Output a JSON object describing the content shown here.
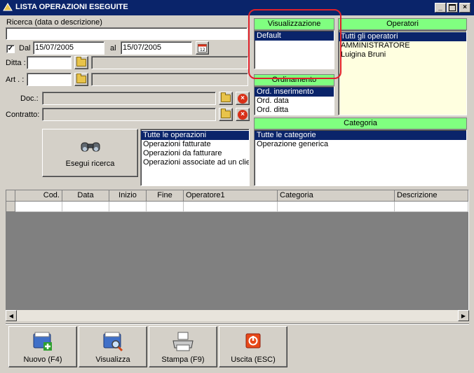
{
  "window": {
    "title": "LISTA OPERAZIONI ESEGUITE"
  },
  "search": {
    "label": "Ricerca (data o descrizione)",
    "value": "",
    "dal_label": "Dal",
    "dal_checked": true,
    "date_from": "15/07/2005",
    "al_label": "al",
    "date_to": "15/07/2005",
    "ditta_label": "Ditta :",
    "art_label": "Art . :",
    "doc_label": "Doc.:",
    "contratto_label": "Contratto:",
    "exec_button": "Esegui ricerca"
  },
  "operation_filter": {
    "items": [
      "Tutte le operazioni",
      "Operazioni fatturate",
      "Operazioni da fatturare",
      "Operazioni associate ad un clier"
    ],
    "selected_index": 0
  },
  "visualizzazione": {
    "header": "Visualizzazione",
    "items": [
      "Default"
    ],
    "selected_index": 0
  },
  "ordinamento": {
    "header": "Ordinamento",
    "items": [
      "Ord. inserimento",
      "Ord. data",
      "Ord. ditta"
    ],
    "selected_index": 0
  },
  "operatori": {
    "header": "Operatori",
    "items": [
      "Tutti gli operatori",
      "AMMINISTRATORE",
      "Luigina Bruni"
    ],
    "selected_index": 0
  },
  "categoria": {
    "header": "Categoria",
    "items": [
      "Tutte le categorie",
      "Operazione generica"
    ],
    "selected_index": 0
  },
  "grid": {
    "columns": [
      "Cod.",
      "Data",
      "Inizio",
      "Fine",
      "Operatore1",
      "Categoria",
      "Descrizione"
    ]
  },
  "footer": {
    "new_button": "Nuovo (F4)",
    "view_button": "Visualizza",
    "print_button": "Stampa (F9)",
    "exit_button": "Uscita (ESC)"
  },
  "colors": {
    "header_green": "#80ff80",
    "selection": "#0a246a",
    "highlight_red": "#e0202a",
    "operatori_bg": "#ffffe0"
  }
}
